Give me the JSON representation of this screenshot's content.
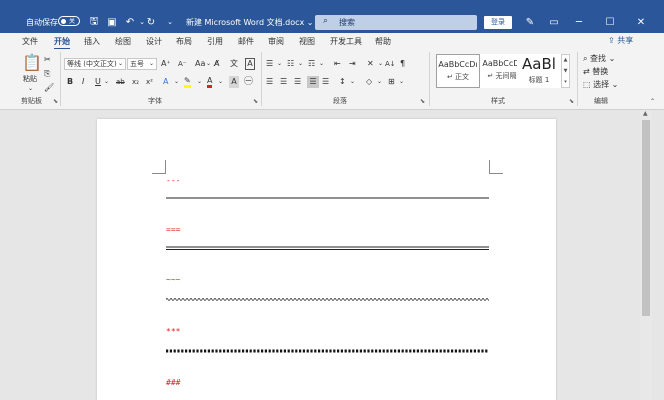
{
  "titlebar": {
    "autosave_label": "自动保存",
    "autosave_state": "关",
    "doc_title": "新建 Microsoft Word 文档.docx ⌄",
    "search_placeholder": "搜索",
    "login_label": "登录",
    "bg_color": "#2b579a"
  },
  "tabs": [
    "文件",
    "开始",
    "插入",
    "绘图",
    "设计",
    "布局",
    "引用",
    "邮件",
    "审阅",
    "视图",
    "开发工具",
    "帮助"
  ],
  "active_tab": "开始",
  "share_label": "共享",
  "ribbon": {
    "clipboard": {
      "paste_label": "粘贴",
      "group_label": "剪贴板"
    },
    "font": {
      "font_name": "等线 (中文正文)",
      "font_size": "五号",
      "group_label": "字体"
    },
    "paragraph": {
      "group_label": "段落"
    },
    "styles": {
      "items": [
        {
          "preview": "AaBbCcDı",
          "name": "↵ 正文"
        },
        {
          "preview": "AaBbCcDı",
          "name": "↵ 无间隔"
        },
        {
          "preview": "AaBl",
          "name": "标题 1"
        }
      ],
      "group_label": "样式"
    },
    "editing": {
      "find_label": "查找",
      "replace_label": "替换",
      "select_label": "选择",
      "group_label": "编辑"
    }
  },
  "document": {
    "marks": [
      "---",
      "===",
      "~~~",
      "***",
      "###"
    ]
  }
}
